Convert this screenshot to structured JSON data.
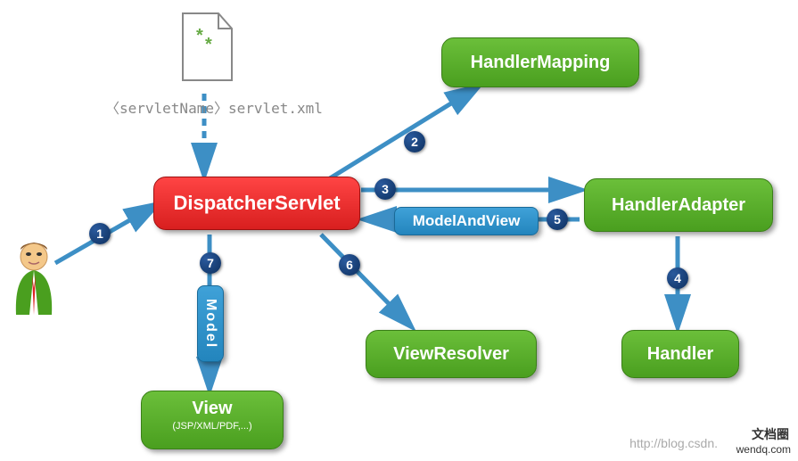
{
  "nodes": {
    "config_label": "〈servletName〉servlet.xml",
    "dispatcher": "DispatcherServlet",
    "handler_mapping": "HandlerMapping",
    "handler_adapter": "HandlerAdapter",
    "handler": "Handler",
    "view_resolver": "ViewResolver",
    "view_title": "View",
    "view_sub": "(JSP/XML/PDF,...)",
    "model_and_view": "ModelAndView",
    "model": "Model"
  },
  "steps": {
    "s1": "1",
    "s2": "2",
    "s3": "3",
    "s4": "4",
    "s5": "5",
    "s6": "6",
    "s7": "7"
  },
  "footer": {
    "url": "http://blog.csdn.",
    "wm1": "文档圈",
    "wm2": "wendq.com"
  }
}
